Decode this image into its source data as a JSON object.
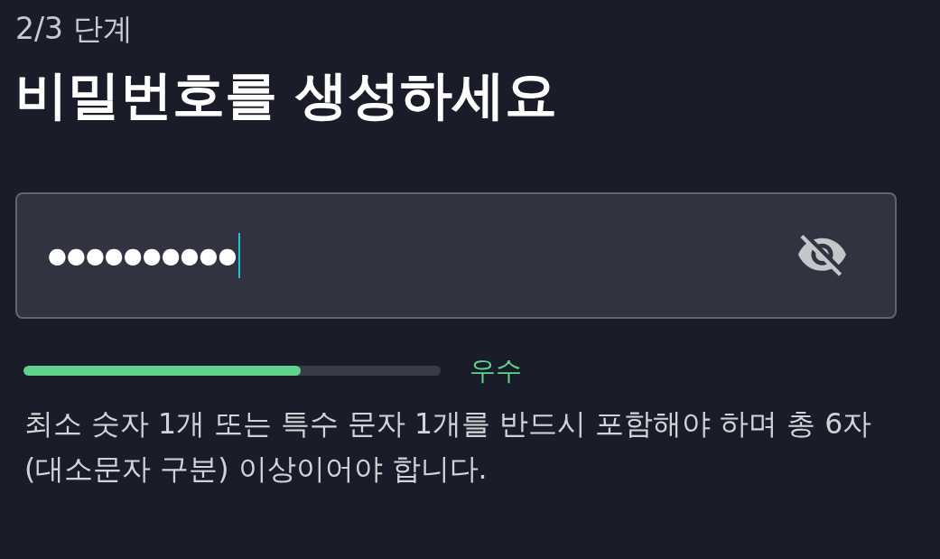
{
  "step": "2/3 단계",
  "title": "비밀번호를 생성하세요",
  "password_field": {
    "value": "●●●●●●●●●●",
    "focused": true,
    "masked": true
  },
  "strength": {
    "level": 0.665,
    "label": "우수"
  },
  "hint": "최소 숫자 1개 또는 특수 문자 1개를 반드시 포함해야 하며 총 6자 (대소문자 구분) 이상이어야 합니다."
}
